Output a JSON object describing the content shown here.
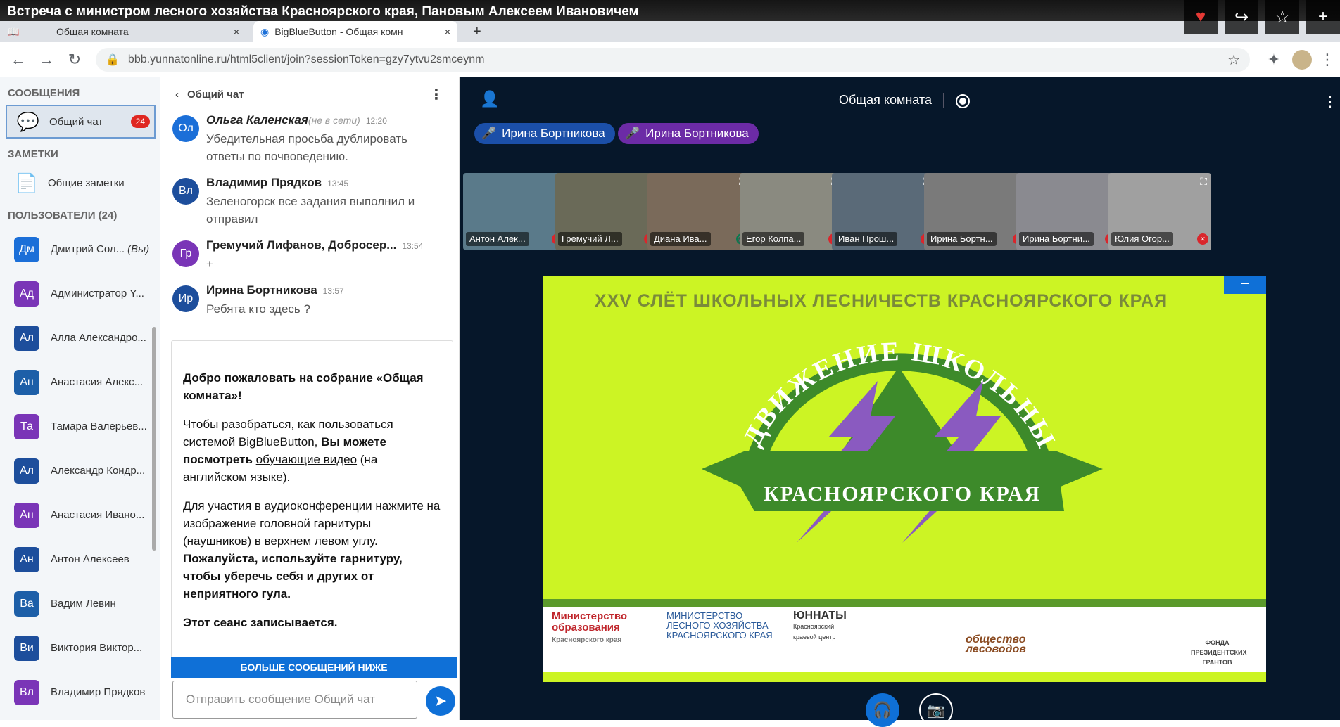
{
  "yt_title": "Встреча с министром лесного хозяйства Красноярского края, Пановым Алексеем Ивановичем",
  "tabs": [
    "Общая комната",
    "BigBlueButton - Общая комн"
  ],
  "url": "bbb.yunnatonline.ru/html5client/join?sessionToken=gzy7ytvu2smceynm",
  "left": {
    "messages_h": "СООБЩЕНИЯ",
    "chat_link": "Общий чат",
    "chat_badge": "24",
    "notes_h": "ЗАМЕТКИ",
    "notes_link": "Общие заметки",
    "users_h": "ПОЛЬЗОВАТЕЛИ (24)",
    "users": [
      {
        "ini": "Дм",
        "name": "Дмитрий Сол...",
        "you": "(Вы)",
        "color": "#1b6fd8",
        "st": "#0a7a4e"
      },
      {
        "ini": "Ад",
        "name": "Администратор Y...",
        "color": "#7a35b7",
        "st": ""
      },
      {
        "ini": "Ал",
        "name": "Алла Александро...",
        "color": "#1d4e9c",
        "st": "#d9262c"
      },
      {
        "ini": "Ан",
        "name": "Анастасия Алекс...",
        "color": "#1d5fa8",
        "st": "#d9262c"
      },
      {
        "ini": "Та",
        "name": "Тамара Валерьев...",
        "color": "#7a35b7",
        "st": "#d9262c"
      },
      {
        "ini": "Ал",
        "name": "Александр Кондр...",
        "color": "#1d4e9c",
        "st": "#d9262c"
      },
      {
        "ini": "Ан",
        "name": "Анастасия Ивано...",
        "color": "#7a35b7",
        "st": "#d9262c"
      },
      {
        "ini": "Ан",
        "name": "Антон Алексеев",
        "color": "#1d4e9c",
        "st": "#d9262c"
      },
      {
        "ini": "Ва",
        "name": "Вадим Левин",
        "color": "#1d5fa8",
        "st": "#0a7a4e"
      },
      {
        "ini": "Ви",
        "name": "Виктория Виктор...",
        "color": "#1d4e9c",
        "st": "#d9262c"
      },
      {
        "ini": "Вл",
        "name": "Владимир Прядков",
        "color": "#7a35b7",
        "st": ""
      }
    ]
  },
  "chat": {
    "title": "Общий чат",
    "messages": [
      {
        "ini": "Ол",
        "color": "#1b6fd8",
        "name": "Ольга Каленская",
        "off": "(не в сети)",
        "time": "12:20",
        "text": "Убедительная просьба дублировать ответы по почвоведению."
      },
      {
        "ini": "Вл",
        "color": "#1d4e9c",
        "name": "Владимир Прядков",
        "time": "13:45",
        "text": "Зеленогорск все задания выполнил и отправил"
      },
      {
        "ini": "Гр",
        "color": "#7a35b7",
        "name": "Гремучий Лифанов, Добросер...",
        "time": "13:54",
        "text": "+"
      },
      {
        "ini": "Ир",
        "color": "#1d4e9c",
        "name": "Ирина Бортникова",
        "time": "13:57",
        "text": "Ребята кто здесь ?"
      }
    ],
    "w1a": "Добро пожаловать на собрание «",
    "w1b": "Общая комната",
    "w1c": "»!",
    "w2a": "Чтобы разобраться, как пользоваться системой BigBlueButton, ",
    "w2b": "Вы можете посмотреть ",
    "w2c": "обучающие видео",
    "w2d": " (на английском языке).",
    "w3a": "Для участия в аудиоконференции нажмите на изображение головной гарнитуры (наушников) в верхнем левом углу. ",
    "w3b": "Пожалуйста, используйте гарнитуру, чтобы уберечь себя и других от неприятного гула.",
    "w4": "Этот сеанс записывается.",
    "more": "БОЛЬШЕ СООБЩЕНИЙ НИЖЕ",
    "placeholder": "Отправить сообщение Общий чат"
  },
  "main": {
    "room": "Общая комната",
    "talkers": [
      "Ирина Бортникова",
      "Ирина Бортникова"
    ],
    "videos": [
      "Антон Алек...",
      "Гремучий Л...",
      "Диана Ива...",
      "Егор Колпа...",
      "Иван Прош...",
      "Ирина Бортн...",
      "Ирина Бортни...",
      "Юлия Огор..."
    ],
    "slide_title": "XXV СЛЁТ ШКОЛЬНЫХ ЛЕСНИЧЕСТВ КРАСНОЯРСКОГО КРАЯ",
    "arc_top": "ДВИЖЕНИЕ ШКОЛЬНЫХ ЛЕСНИЧЕСТВ",
    "ribbon": "КРАСНОЯРСКОГО КРАЯ",
    "logo1": "Министерство образования",
    "logo1b": "Красноярского края",
    "logo2": "МИНИСТЕРСТВО ЛЕСНОГО ХОЗЯЙСТВА КРАСНОЯРСКОГО КРАЯ",
    "logo3": "ЮННАТЫ",
    "logo3b": "Красноярский краевой центр",
    "logo4": "общество лесоводов",
    "logo5": "ФОНДА ПРЕЗИДЕНТСКИХ ГРАНТОВ"
  }
}
